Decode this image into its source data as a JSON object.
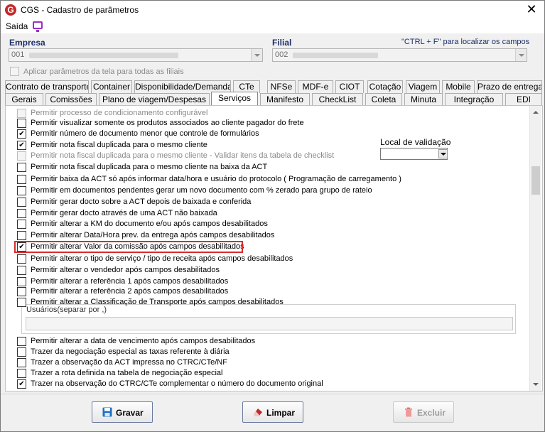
{
  "window": {
    "title": "CGS - Cadastro de parâmetros",
    "close_glyph": "✕"
  },
  "menu": {
    "saida": "Saída"
  },
  "empresa": {
    "label": "Empresa",
    "code": "001"
  },
  "filial": {
    "label": "Filial",
    "code": "002"
  },
  "hint": "\"CTRL + F\" para localizar os campos",
  "apply_all": {
    "label": "Aplicar parâmetros da tela para todas as filiais",
    "checked": false
  },
  "tabs_row1": [
    "Contrato de transporte",
    "Container",
    "Disponibilidade/Demanda",
    "CTe",
    "NFSe",
    "MDF-e",
    "CIOT",
    "Cotação",
    "Viagem",
    "Mobile",
    "Prazo de entrega"
  ],
  "tabs_row2": [
    "Gerais",
    "Comissões",
    "Plano de viagem/Despesas",
    "Serviços",
    "Manifesto",
    "CheckList",
    "Coleta",
    "Minuta",
    "Integração",
    "EDI"
  ],
  "selected_tab": "Serviços",
  "options": [
    {
      "label": "Permitir processo de condicionamento configurável",
      "checked": false,
      "disabled": true
    },
    {
      "label": "Permitir visualizar somente os produtos associados ao cliente pagador do frete",
      "checked": false,
      "disabled": false
    },
    {
      "label": "Permitir número de documento menor que controle de formulários",
      "checked": true,
      "disabled": false
    },
    {
      "label": "Permitir nota fiscal duplicada para o mesmo cliente",
      "checked": true,
      "disabled": false
    },
    {
      "label": "Permitir nota fiscal duplicada para o mesmo cliente - Validar itens da tabela de checklist",
      "checked": false,
      "disabled": true
    },
    {
      "label": "Permitir nota fiscal duplicada para o mesmo cliente na baixa da ACT",
      "checked": false,
      "disabled": false
    },
    {
      "label": "Permitir baixa da ACT só após informar data/hora e usuário do protocolo ( Programação de carregamento )",
      "checked": false,
      "disabled": false
    },
    {
      "label": "Permitir em documentos pendentes gerar um novo documento com % zerado para grupo de rateio",
      "checked": false,
      "disabled": false
    },
    {
      "label": "Permitir gerar docto sobre a ACT depois de baixada e conferida",
      "checked": false,
      "disabled": false
    },
    {
      "label": "Permitir gerar docto através de uma ACT não baixada",
      "checked": false,
      "disabled": false
    },
    {
      "label": "Permitir alterar a KM do documento e/ou após campos desabilitados",
      "checked": false,
      "disabled": false
    },
    {
      "label": "Permitir alterar Data/Hora prev. da entrega após campos desabilitados",
      "checked": false,
      "disabled": false
    },
    {
      "label": "Permitir alterar Valor da comissão após campos desabilitados",
      "checked": true,
      "disabled": false
    },
    {
      "label": "Permitir alterar o tipo de serviço / tipo de receita após campos desabilitados",
      "checked": false,
      "disabled": false
    },
    {
      "label": "Permitir alterar o vendedor após campos desabilitados",
      "checked": false,
      "disabled": false
    },
    {
      "label": "Permitir alterar a referência 1 após campos desabilitados",
      "checked": false,
      "disabled": false
    },
    {
      "label": "Permitir alterar a referência 2 após campos desabilitados",
      "checked": false,
      "disabled": false
    },
    {
      "label": "Permitir alterar a Classificação de Transporte após campos desabilitados",
      "checked": false,
      "disabled": false
    }
  ],
  "users_group": {
    "caption": "Usuários(separar por ,)",
    "value": ""
  },
  "options_after": [
    {
      "label": "Permitir alterar a data de vencimento após campos desabilitados",
      "checked": false,
      "disabled": false
    },
    {
      "label": "Trazer da negociação especial as taxas referente à diária",
      "checked": false,
      "disabled": false
    },
    {
      "label": "Trazer a observação da ACT impressa no CTRC/CTe/NF",
      "checked": false,
      "disabled": false
    },
    {
      "label": "Trazer a rota definida na tabela de negociação especial",
      "checked": false,
      "disabled": false
    },
    {
      "label": "Trazer na observação do CTRC/CTe complementar o número do documento original",
      "checked": true,
      "disabled": false
    }
  ],
  "local_validacao": {
    "label": "Local de validação",
    "value": ""
  },
  "buttons": {
    "gravar": "Gravar",
    "limpar": "Limpar",
    "excluir": "Excluir"
  },
  "colors": {
    "accent": "#1c2f6b",
    "highlight": "#d32f2f",
    "menu_icon": "#9b30c9"
  }
}
